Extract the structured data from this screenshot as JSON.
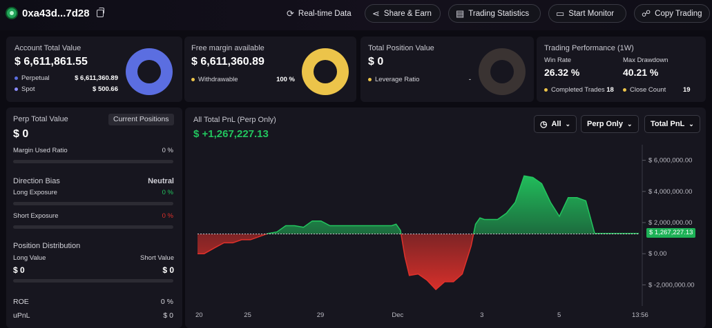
{
  "header": {
    "address": "0xa43d...7d28",
    "realtime_label": "Real-time Data",
    "share_label": "Share & Earn",
    "stats_label": "Trading Statistics",
    "monitor_label": "Start Monitor",
    "copy_label": "Copy Trading"
  },
  "cards": {
    "account": {
      "title": "Account Total Value",
      "value": "$ 6,611,861.55",
      "perp_label": "Perpetual",
      "perp_value": "$ 6,611,360.89",
      "spot_label": "Spot",
      "spot_value": "$ 500.66",
      "perp_share": 0.99992
    },
    "margin": {
      "title": "Free margin available",
      "value": "$ 6,611,360.89",
      "withdraw_label": "Withdrawable",
      "withdraw_value": "100 %",
      "withdraw_share": 1.0
    },
    "position": {
      "title": "Total Position Value",
      "value": "$ 0",
      "leverage_label": "Leverage Ratio",
      "leverage_value": "-"
    },
    "performance": {
      "title": "Trading Performance (1W)",
      "winrate_label": "Win Rate",
      "winrate_value": "26.32 %",
      "drawdown_label": "Max Drawdown",
      "drawdown_value": "40.21 %",
      "completed_label": "Completed Trades",
      "completed_value": "18",
      "close_label": "Close Count",
      "close_value": "19"
    }
  },
  "left": {
    "perp_title": "Perp Total Value",
    "positions_button": "Current Positions",
    "perp_value": "$ 0",
    "margin_used_label": "Margin Used Ratio",
    "margin_used_value": "0 %",
    "margin_used": 0,
    "bias_label": "Direction Bias",
    "bias_value": "Neutral",
    "long_exp_label": "Long Exposure",
    "long_exp_value": "0 %",
    "long_exp": 0,
    "short_exp_label": "Short Exposure",
    "short_exp_value": "0 %",
    "short_exp": 0,
    "dist_title": "Position Distribution",
    "long_value_label": "Long Value",
    "long_value": "$ 0",
    "short_value_label": "Short Value",
    "short_value": "$ 0",
    "roe_label": "ROE",
    "roe_value": "0 %",
    "upnl_label": "uPnL",
    "upnl_value": "$ 0"
  },
  "chart_panel": {
    "title": "All Total PnL (Perp Only)",
    "value": "$ +1,267,227.13",
    "filter_all": "All",
    "filter_perp": "Perp Only",
    "filter_total": "Total PnL",
    "current_badge": "$ 1,267,227.13"
  },
  "colors": {
    "accent_green": "#22c55e",
    "loss_red": "#e0312b",
    "perp_blue": "#5b6ee1",
    "margin_yellow": "#ecc44a"
  },
  "chart_data": {
    "type": "area",
    "ytick_labels": [
      "$ 6,000,000.00",
      "$ 4,000,000.00",
      "$ 2,000,000.00",
      "$ 0.00",
      "$ -2,000,000.00"
    ],
    "yticks": [
      6000000,
      4000000,
      2000000,
      0,
      -2000000
    ],
    "ylim": [
      -3000000,
      7000000
    ],
    "xtick_labels": [
      "20",
      "25",
      "29",
      "Dec",
      "3",
      "5",
      "13:56"
    ],
    "xtick_pos": [
      0,
      0.11,
      0.275,
      0.445,
      0.645,
      0.82,
      1.0
    ],
    "baseline": 1267227.13,
    "x": [
      0,
      0.015,
      0.04,
      0.06,
      0.08,
      0.1,
      0.12,
      0.14,
      0.16,
      0.18,
      0.2,
      0.22,
      0.24,
      0.26,
      0.28,
      0.3,
      0.32,
      0.34,
      0.36,
      0.38,
      0.4,
      0.42,
      0.44,
      0.45,
      0.46,
      0.47,
      0.48,
      0.5,
      0.52,
      0.54,
      0.56,
      0.58,
      0.6,
      0.62,
      0.63,
      0.64,
      0.65,
      0.66,
      0.68,
      0.7,
      0.72,
      0.74,
      0.76,
      0.78,
      0.8,
      0.82,
      0.84,
      0.86,
      0.88,
      0.9,
      0.92,
      0.94,
      0.96,
      0.98,
      1.0
    ],
    "y": [
      0,
      0,
      400000,
      700000,
      700000,
      900000,
      900000,
      1100000,
      1300000,
      1400000,
      1800000,
      1800000,
      1700000,
      2100000,
      2100000,
      1800000,
      1800000,
      1800000,
      1800000,
      1800000,
      1800000,
      1800000,
      1800000,
      1900000,
      1500000,
      -200000,
      -1400000,
      -1300000,
      -1700000,
      -2300000,
      -1800000,
      -1800000,
      -1300000,
      500000,
      1900000,
      2300000,
      2200000,
      2200000,
      2200000,
      2600000,
      3300000,
      5000000,
      4900000,
      4500000,
      3300000,
      2400000,
      3600000,
      3600000,
      3400000,
      1300000,
      1300000,
      1300000,
      1300000,
      1300000,
      1300000
    ]
  }
}
